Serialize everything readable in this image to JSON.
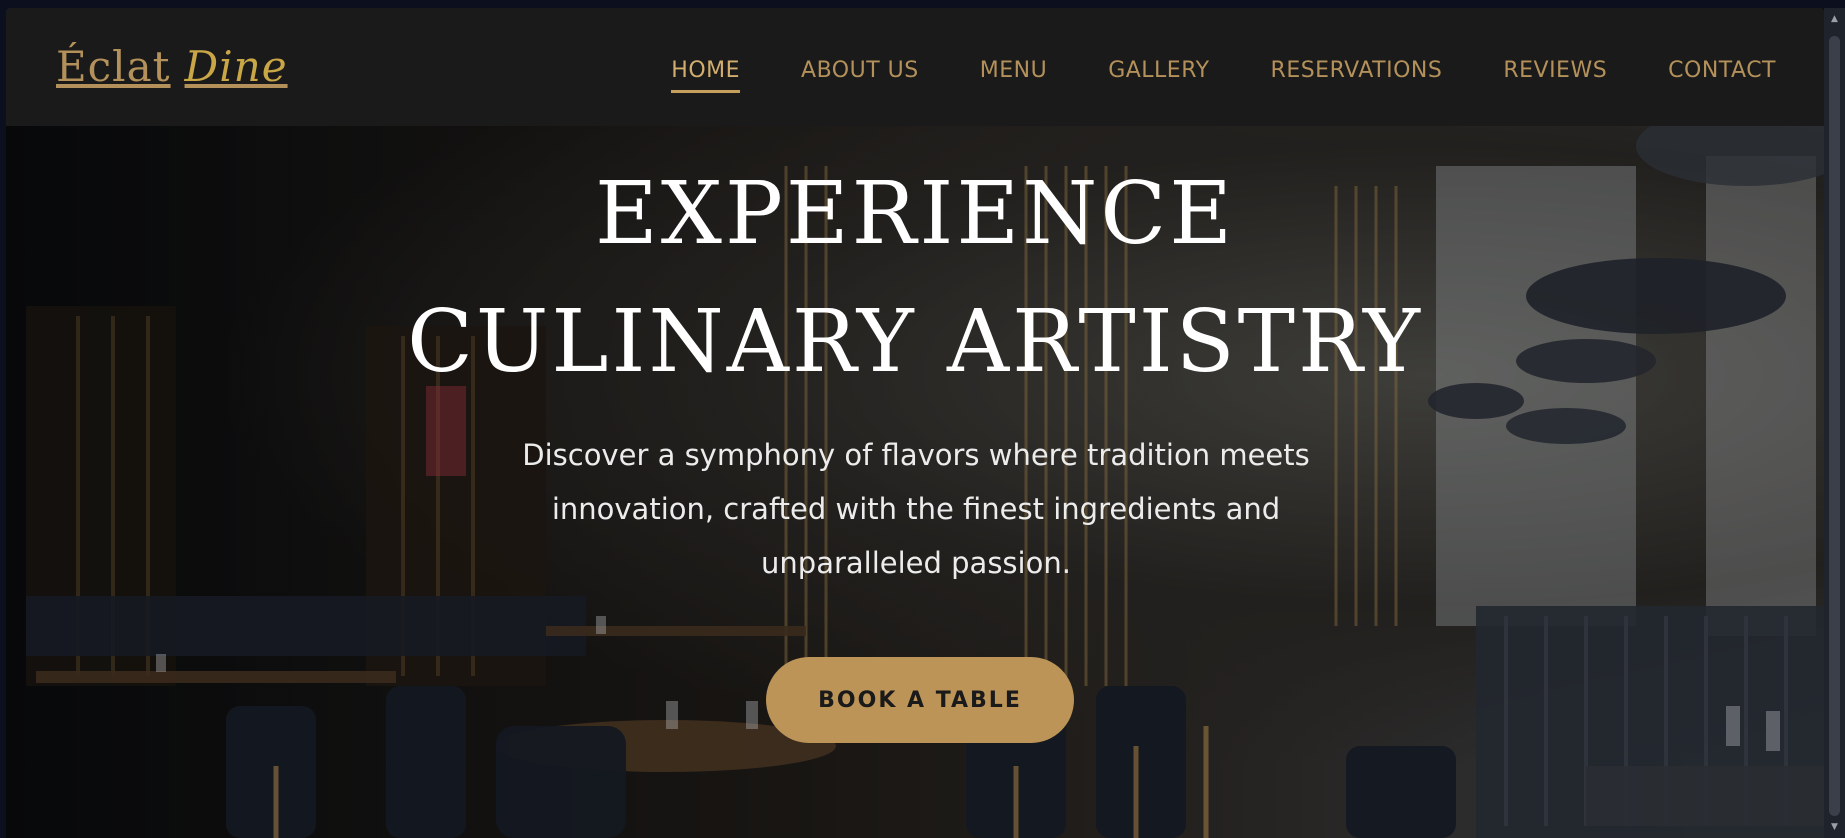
{
  "brand": {
    "name": "Éclat",
    "accent": "Dine"
  },
  "nav": {
    "items": [
      {
        "label": "HOME",
        "active": true
      },
      {
        "label": "ABOUT US",
        "active": false
      },
      {
        "label": "MENU",
        "active": false
      },
      {
        "label": "GALLERY",
        "active": false
      },
      {
        "label": "RESERVATIONS",
        "active": false
      },
      {
        "label": "REVIEWS",
        "active": false
      },
      {
        "label": "CONTACT",
        "active": false
      }
    ]
  },
  "hero": {
    "title_line1": "EXPERIENCE",
    "title_line2": "CULINARY ARTISTRY",
    "subtitle_line1": "Discover a symphony of flavors where tradition meets",
    "subtitle_line2": "innovation, crafted with the finest ingredients and",
    "subtitle_line3": "unparalleled passion.",
    "cta_label": "BOOK A TABLE"
  },
  "colors": {
    "gold": "#b4915a",
    "gold_bright": "#c9a646",
    "cta_bg": "#bd9457",
    "header_bg": "#1a1a1a"
  }
}
